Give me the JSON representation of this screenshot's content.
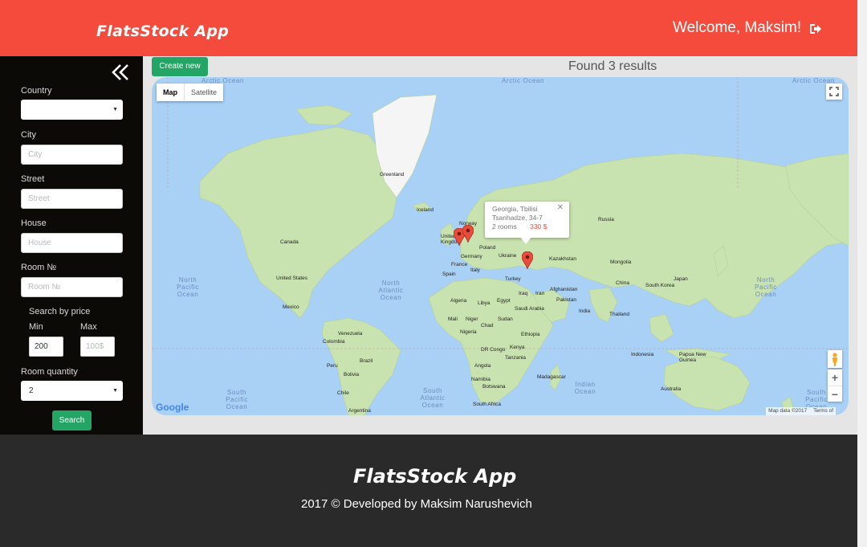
{
  "header": {
    "brand": "FlatsStock App",
    "welcome": "Welcome, Maksim!",
    "logout_icon": "sign-out-icon"
  },
  "sidebar": {
    "collapse_icon": "double-chevron-left-icon",
    "country": {
      "label": "Country",
      "value": ""
    },
    "city": {
      "label": "City",
      "placeholder": "City"
    },
    "street": {
      "label": "Street",
      "placeholder": "Street"
    },
    "house": {
      "label": "House",
      "placeholder": "House"
    },
    "room": {
      "label": "Room №",
      "placeholder": "Room №"
    },
    "price": {
      "label": "Search by price",
      "min_label": "Min",
      "min_value": "200",
      "max_label": "Max",
      "max_placeholder": "100$"
    },
    "room_quantity": {
      "label": "Room quantity",
      "value": "2"
    },
    "search_button": "Search"
  },
  "main": {
    "create_button": "Create new",
    "results_text": "Found 3 results"
  },
  "map": {
    "type_controls": [
      "Map",
      "Satellite"
    ],
    "info_window": {
      "line1": "Georgia, Tbilisi",
      "line2": "Tsanhadze, 34-7",
      "rooms": "2 rooms",
      "price": "330 $"
    },
    "labels": {
      "arctic1": "Arctic Ocean",
      "arctic2": "Arctic Ocean",
      "arctic3": "Arctic Ocean",
      "greenland": "Greenland",
      "iceland": "Iceland",
      "norway": "Norway",
      "united_kingdom": "United Kingdom",
      "germany": "Germany",
      "poland": "Poland",
      "ukraine": "Ukraine",
      "france": "France",
      "spain": "Spain",
      "italy": "Italy",
      "turkey": "Turkey",
      "russia": "Russia",
      "kazakhstan": "Kazakhstan",
      "mongolia": "Mongolia",
      "china": "China",
      "south_korea": "South Korea",
      "japan": "Japan",
      "afghanistan": "Afghanistan",
      "pakistan": "Pakistan",
      "india": "India",
      "iran": "Iran",
      "iraq": "Iraq",
      "saudi_arabia": "Saudi Arabia",
      "egypt": "Egypt",
      "libya": "Libya",
      "algeria": "Algeria",
      "mali": "Mali",
      "niger": "Niger",
      "chad": "Chad",
      "sudan": "Sudan",
      "nigeria": "Nigeria",
      "ethiopia": "Ethiopia",
      "kenya": "Kenya",
      "dr_congo": "DR Congo",
      "tanzania": "Tanzania",
      "angola": "Angola",
      "namibia": "Namibia",
      "botswana": "Botswana",
      "south_africa": "South Africa",
      "madagascar": "Madagascar",
      "thailand": "Thailand",
      "indonesia": "Indonesia",
      "papua_new_guinea": "Papua New Guinea",
      "australia": "Australia",
      "canada": "Canada",
      "united_states": "United States",
      "mexico": "Mexico",
      "venezuela": "Venezuela",
      "colombia": "Colombia",
      "peru": "Peru",
      "brazil": "Brazil",
      "bolivia": "Bolivia",
      "chile": "Chile",
      "argentina": "Argentina"
    },
    "oceans": {
      "north_pacific_left": "North Pacific Ocean",
      "north_atlantic": "North Atlantic Ocean",
      "north_pacific_right": "North Pacific Ocean",
      "south_pacific_left": "South Pacific Ocean",
      "south_atlantic": "South Atlantic Ocean",
      "indian": "Indian Ocean",
      "south_pacific_right": "South Pacific Ocean"
    },
    "google_logo": "Google",
    "attribution": {
      "data": "Map data ©2017",
      "terms": "Terms of"
    }
  },
  "footer": {
    "title": "FlatsStock App",
    "copyright": "2017 © Developed by Maksim Narushevich"
  },
  "colors": {
    "header": "#f44b3c",
    "sidebar": "#0b0a07",
    "accent_green": "#22a565",
    "footer": "#2b2a2a",
    "water": "#a9d0f5",
    "land": "#c9e3b0"
  }
}
